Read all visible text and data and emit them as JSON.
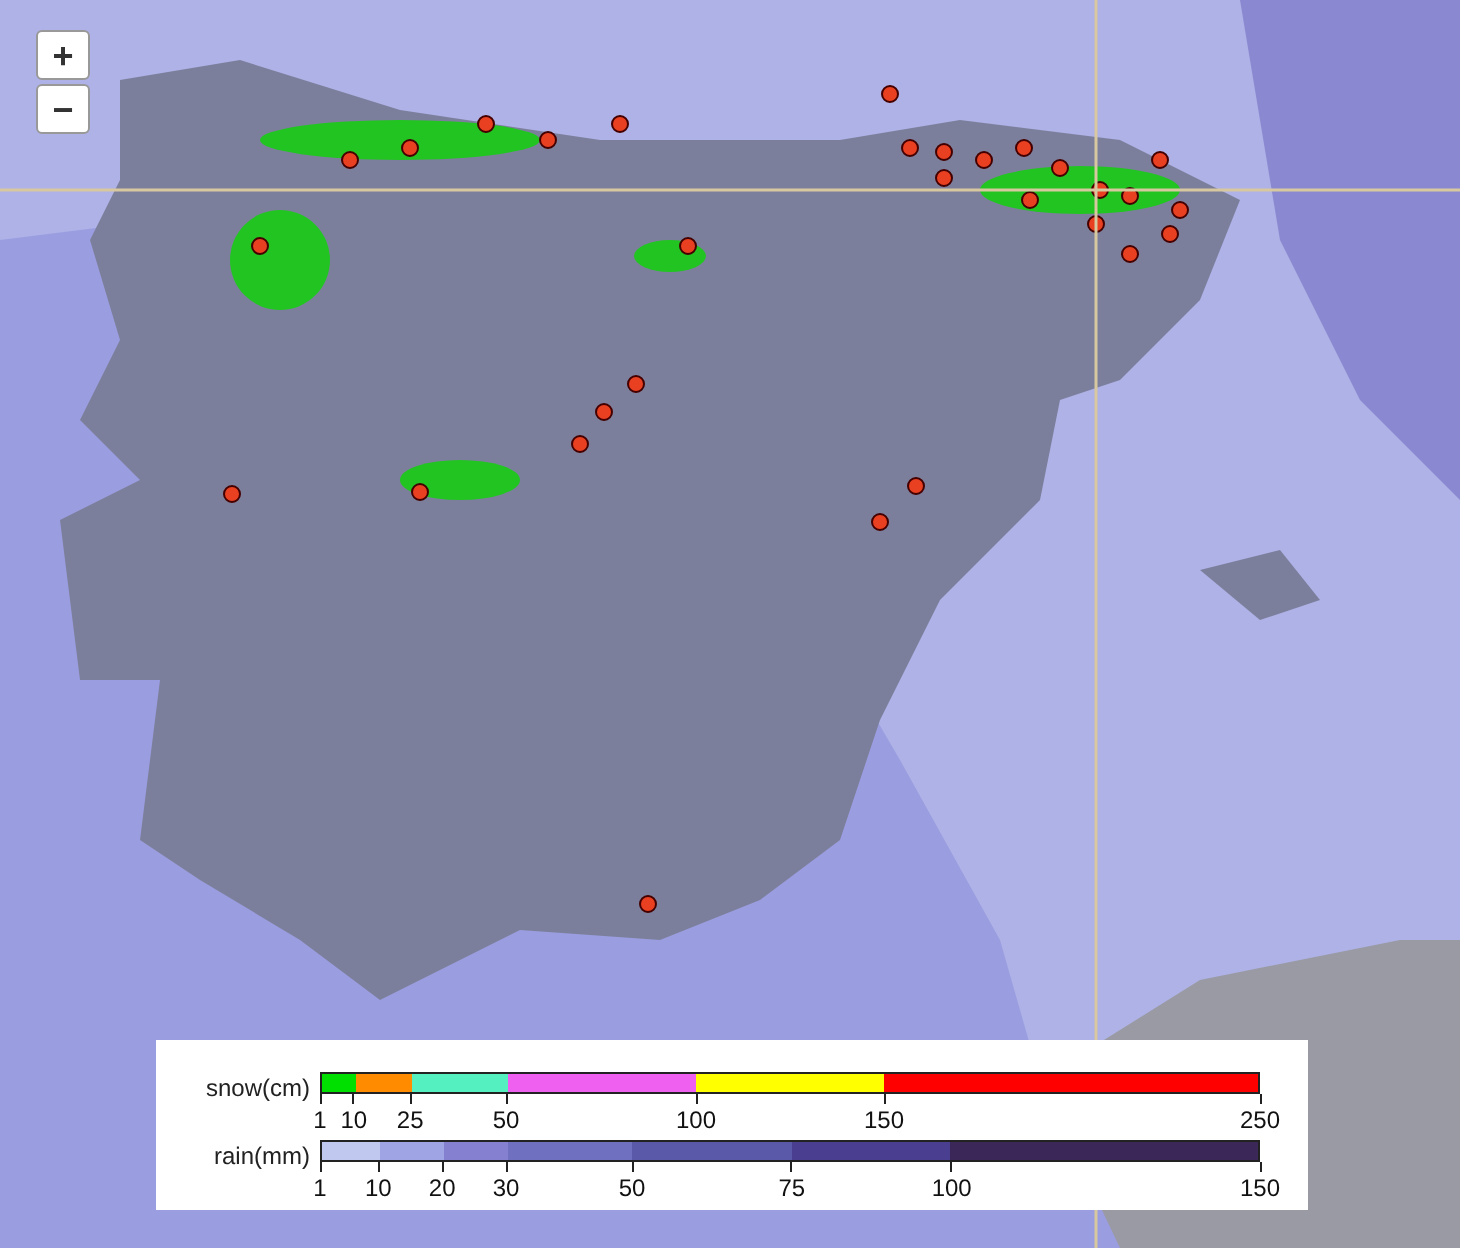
{
  "zoom_controls": [
    {
      "label": "+"
    },
    {
      "label": "−"
    }
  ],
  "legend": {
    "scales": [
      {
        "label": "snow(cm)",
        "segments": [
          {
            "color": "#00e000"
          },
          {
            "color": "#ff8c00"
          },
          {
            "color": "#55f0c0"
          },
          {
            "color": "#f060f0"
          },
          {
            "color": "#ffff00"
          },
          {
            "color": "#ff0000"
          }
        ],
        "ticks": [
          "1",
          "10",
          "25",
          "50",
          "100",
          "150",
          "250"
        ]
      },
      {
        "label": "rain(mm)",
        "segments": [
          {
            "color": "#c0c8f0"
          },
          {
            "color": "#9ea4e4"
          },
          {
            "color": "#8580d0"
          },
          {
            "color": "#7070c0"
          },
          {
            "color": "#5a58a8"
          },
          {
            "color": "#4a3e90"
          },
          {
            "color": "#3c2858"
          }
        ],
        "ticks": [
          "1",
          "10",
          "20",
          "30",
          "50",
          "75",
          "100",
          "150"
        ]
      }
    ]
  }
}
